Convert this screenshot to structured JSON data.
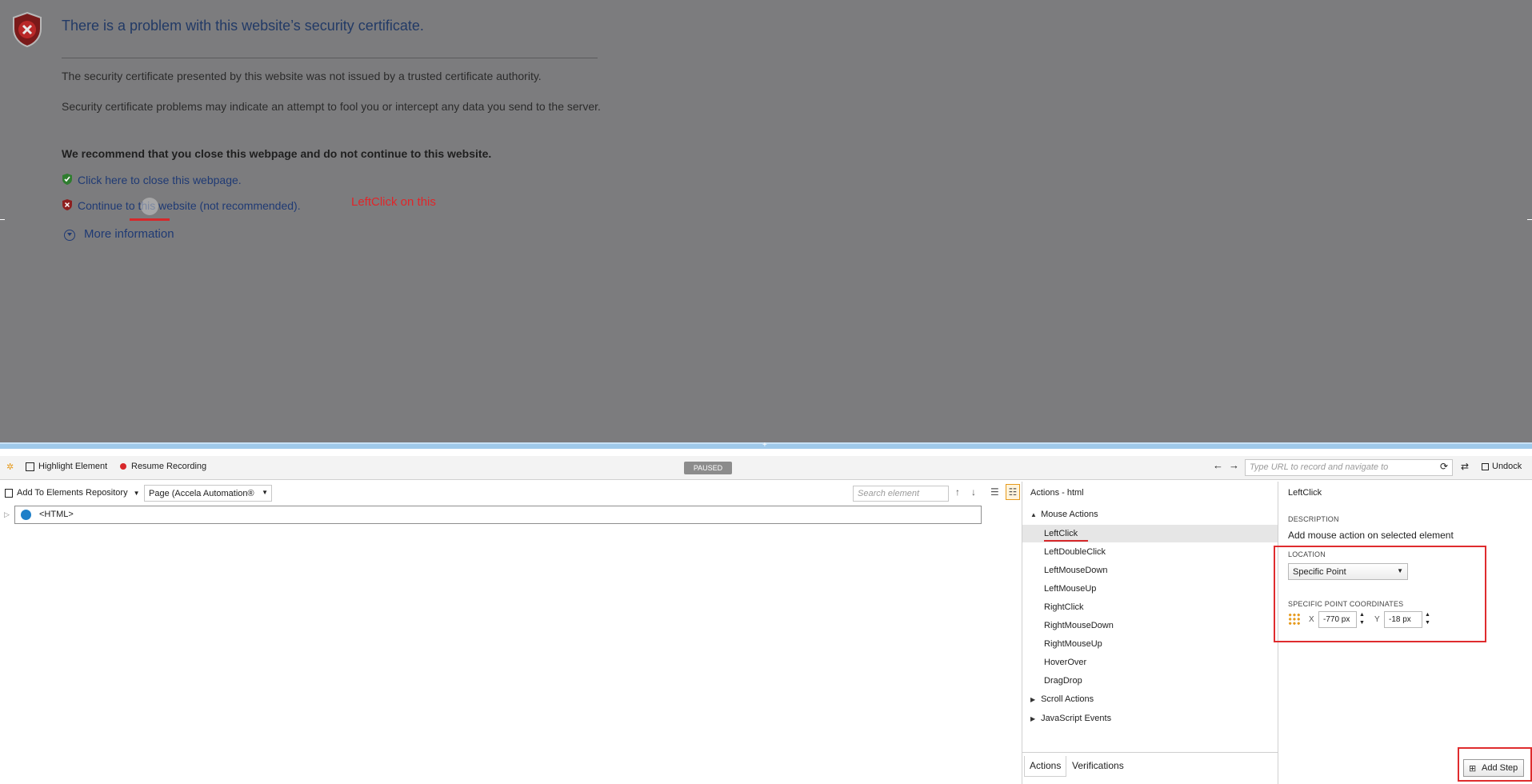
{
  "browser": {
    "title": "There is a problem with this website’s security certificate.",
    "p1": "The security certificate presented by this website was not issued by a trusted certificate authority.",
    "p2": "Security certificate problems may indicate an attempt to fool you or intercept any data you send to the server.",
    "p3": "We recommend that you close this webpage and do not continue to this website.",
    "close_link": "Click here to close this webpage.",
    "continue_link": "Continue to this website (not recommended).",
    "annotation": "LeftClick on this",
    "more_info": "More information"
  },
  "toolbar": {
    "highlight": "Highlight Element",
    "resume": "Resume Recording",
    "paused": "PAUSED",
    "url_placeholder": "Type URL to record and navigate to",
    "undock": "Undock"
  },
  "row2": {
    "add_repo": "Add To Elements Repository",
    "page_select": "Page (Accela Automation®",
    "search_placeholder": "Search element"
  },
  "tree": {
    "root": "<HTML>"
  },
  "actions": {
    "header": "Actions - html",
    "mouse_group": "Mouse Actions",
    "items": [
      "LeftClick",
      "LeftDoubleClick",
      "LeftMouseDown",
      "LeftMouseUp",
      "RightClick",
      "RightMouseDown",
      "RightMouseUp",
      "HoverOver",
      "DragDrop"
    ],
    "scroll_group": "Scroll Actions",
    "js_group": "JavaScript Events",
    "tab_actions": "Actions",
    "tab_verifications": "Verifications"
  },
  "props": {
    "title": "LeftClick",
    "description_label": "DESCRIPTION",
    "description": "Add mouse action on selected element",
    "location_label": "LOCATION",
    "location_value": "Specific Point",
    "coords_label": "SPECIFIC POINT COORDINATES",
    "x_label": "X",
    "x_value": "-770 px",
    "y_label": "Y",
    "y_value": "-18 px",
    "add_step": "Add Step"
  },
  "colors": {
    "overlay": "#7c7c7e",
    "annotation_red": "#e0262a",
    "link_blue": "#1f3a74",
    "splitter": "#9fc9ea"
  }
}
